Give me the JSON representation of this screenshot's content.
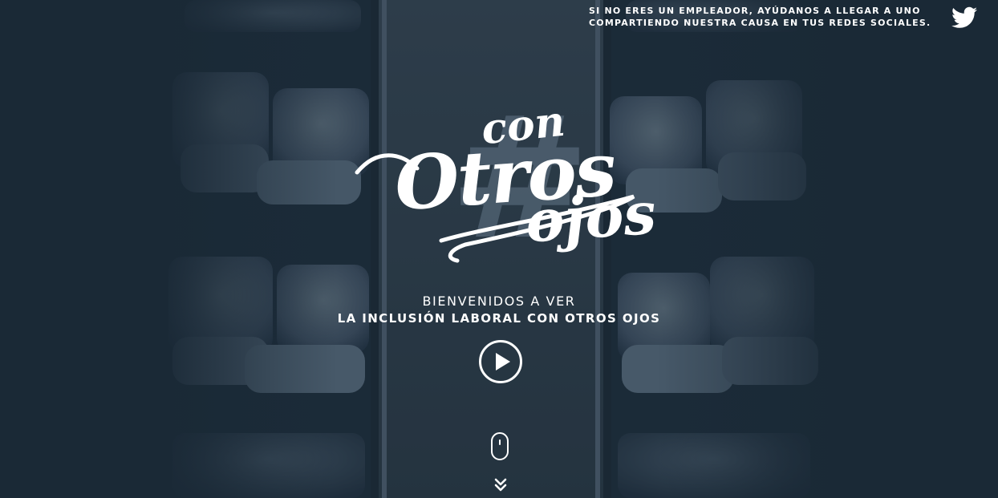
{
  "share": {
    "line1": "SI NO ERES UN EMPLEADOR, AYÚDANOS A LLEGAR A UNO",
    "line2": "COMPARTIENDO NUESTRA CAUSA EN TUS REDES SOCIALES.",
    "icon": "twitter-icon"
  },
  "logo": {
    "con": "con",
    "otros": "Otros",
    "ojos": "ojos",
    "hash": "#"
  },
  "welcome": {
    "line1": "BIENVENIDOS A VER",
    "line2": "LA INCLUSIÓN LABORAL CON OTROS OJOS"
  },
  "controls": {
    "play_icon": "play-icon",
    "scroll_icon": "mouse-scroll-icon",
    "chevron_icon": "double-chevron-down-icon"
  },
  "colors": {
    "background": "#1a2936",
    "text": "#ffffff",
    "logo_hash": "#6e8294"
  }
}
